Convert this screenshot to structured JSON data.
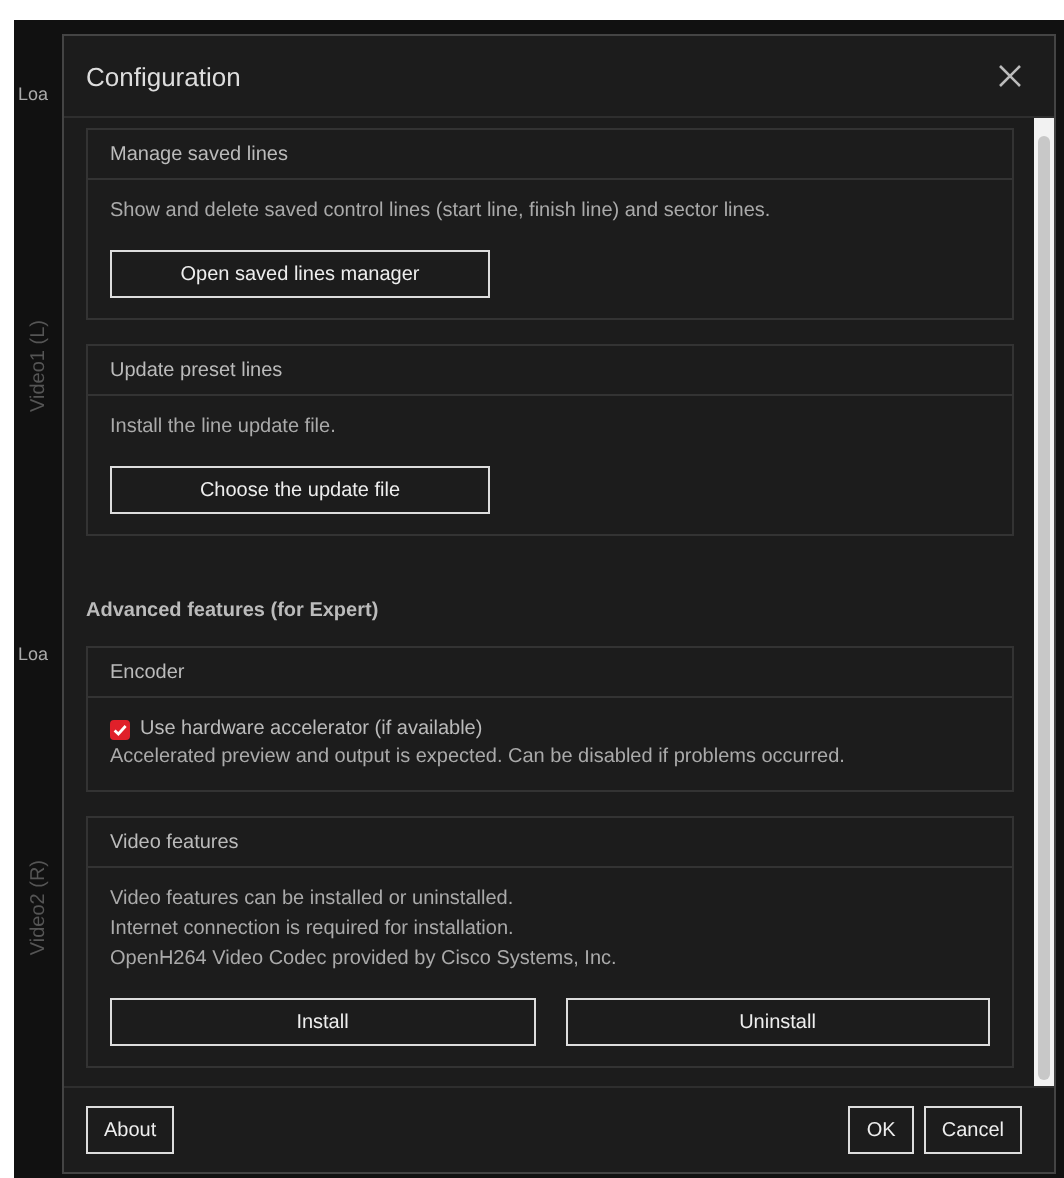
{
  "app": {
    "left_labels": [
      "Loa",
      "Loa"
    ],
    "video_labels": [
      "Video1 (L)",
      "Video2 (R)"
    ]
  },
  "dialog": {
    "title": "Configuration",
    "sections": [
      {
        "kind": "panel",
        "title": "Manage saved lines",
        "body": [
          {
            "kind": "text",
            "text": "Show and delete saved control lines (start line, finish line) and sector lines."
          },
          {
            "kind": "buttons",
            "buttons": [
              "Open saved lines manager"
            ]
          }
        ]
      },
      {
        "kind": "panel",
        "title": "Update preset lines",
        "body": [
          {
            "kind": "text",
            "text": "Install the line update file."
          },
          {
            "kind": "buttons",
            "buttons": [
              "Choose the update file"
            ]
          }
        ]
      },
      {
        "kind": "heading",
        "text": "Advanced features (for Expert)"
      },
      {
        "kind": "panel",
        "title": "Encoder",
        "body": [
          {
            "kind": "checkbox",
            "label": "Use hardware accelerator (if available)",
            "checked": true
          },
          {
            "kind": "text",
            "text": "Accelerated preview and output is expected. Can be disabled if problems occurred."
          }
        ]
      },
      {
        "kind": "panel",
        "title": "Video features",
        "body": [
          {
            "kind": "text",
            "text": "Video features can be installed or uninstalled."
          },
          {
            "kind": "text",
            "text": "Internet connection is required for installation."
          },
          {
            "kind": "text",
            "text": "OpenH264 Video Codec provided by Cisco Systems, Inc."
          },
          {
            "kind": "buttons",
            "buttons": [
              "Install",
              "Uninstall"
            ]
          }
        ]
      }
    ],
    "footer_left": [
      "About"
    ],
    "footer_right": [
      "OK",
      "Cancel"
    ]
  }
}
